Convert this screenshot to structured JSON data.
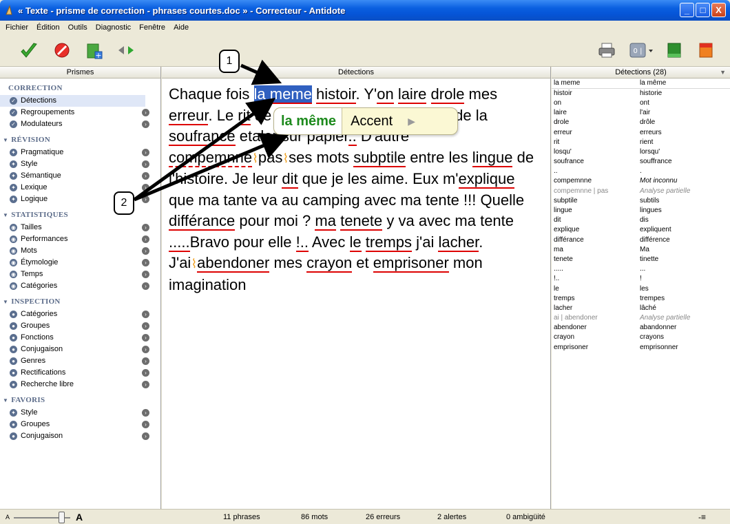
{
  "window": {
    "title": "« Texte - prisme de correction - phrases courtes.doc » - Correcteur - Antidote",
    "buttons": [
      "_",
      "□",
      "X"
    ]
  },
  "menu": [
    "Fichier",
    "Édition",
    "Outils",
    "Diagnostic",
    "Fenêtre",
    "Aide"
  ],
  "panels": {
    "left_title": "Prismes",
    "center_title": "Détections",
    "right_title": "Détections (28)"
  },
  "sidebar": {
    "sections": [
      {
        "title": "CORRECTION",
        "items": [
          "Détections",
          "Regroupements",
          "Modulateurs"
        ]
      },
      {
        "title": "RÉVISION",
        "items": [
          "Pragmatique",
          "Style",
          "Sémantique",
          "Lexique",
          "Logique"
        ]
      },
      {
        "title": "STATISTIQUES",
        "items": [
          "Tailles",
          "Performances",
          "Mots",
          "Étymologie",
          "Temps",
          "Catégories"
        ]
      },
      {
        "title": "INSPECTION",
        "items": [
          "Catégories",
          "Groupes",
          "Fonctions",
          "Conjugaison",
          "Genres",
          "Rectifications",
          "Recherche libre"
        ]
      },
      {
        "title": "FAVORIS",
        "items": [
          "Style",
          "Groupes",
          "Conjugaison"
        ]
      }
    ]
  },
  "popup": {
    "suggestion": "la même",
    "category": "Accent"
  },
  "detections": [
    [
      "la meme",
      "la même"
    ],
    [
      "histoir",
      "historie"
    ],
    [
      "on",
      "ont"
    ],
    [
      "laire",
      "l'air"
    ],
    [
      "drole",
      "drôle"
    ],
    [
      "erreur",
      "erreurs"
    ],
    [
      "rit",
      "rient"
    ],
    [
      "losqu'",
      "lorsqu'"
    ],
    [
      "soufrance",
      "souffrance"
    ],
    [
      "..",
      "."
    ],
    [
      "compemnne",
      "Mot inconnu"
    ],
    [
      "compemnne | pas",
      "Analyse partielle"
    ],
    [
      "subptile",
      "subtils"
    ],
    [
      "lingue",
      "lingues"
    ],
    [
      "dit",
      "dis"
    ],
    [
      "explique",
      "expliquent"
    ],
    [
      "différance",
      "différence"
    ],
    [
      "ma",
      "Ma"
    ],
    [
      "tenete",
      "tinette"
    ],
    [
      ".....",
      "..."
    ],
    [
      "!..",
      "!"
    ],
    [
      "le",
      "les"
    ],
    [
      "tremps",
      "trempes"
    ],
    [
      "lacher",
      "lâché"
    ],
    [
      "ai | abendoner",
      "Analyse partielle"
    ],
    [
      "abendoner",
      "abandonner"
    ],
    [
      "crayon",
      "crayons"
    ],
    [
      "emprisoner",
      "emprisonner"
    ]
  ],
  "status": {
    "phrases": "11 phrases",
    "mots": "86 mots",
    "erreurs": "26 erreurs",
    "alertes": "2 alertes",
    "ambiguite": "0 ambigüité",
    "zoom_small": "A",
    "zoom_large": "A"
  },
  "annotations": {
    "callout1": "1",
    "callout2": "2"
  },
  "colors": {
    "titlebar": "#0a5fe0",
    "error_underline": "#dd0000",
    "selection": "#3060c0",
    "suggestion": "#1d8a1d"
  }
}
